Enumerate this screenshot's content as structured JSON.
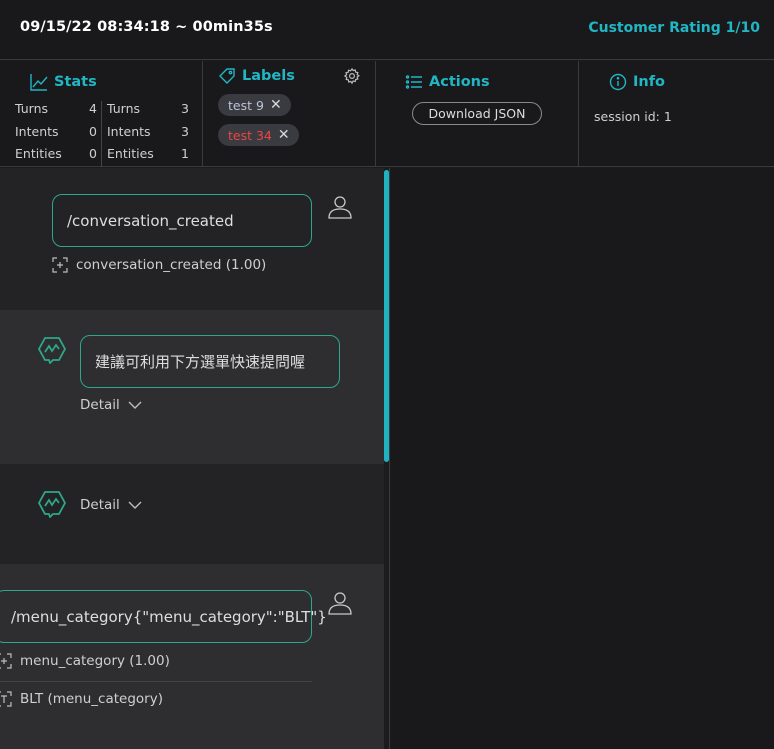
{
  "header": {
    "timestamp": "09/15/22 08:34:18 ~ 00min35s",
    "rating": "Customer Rating 1/10"
  },
  "stats": {
    "title": "Stats",
    "left": [
      {
        "label": "Turns",
        "value": "4"
      },
      {
        "label": "Intents",
        "value": "0"
      },
      {
        "label": "Entities",
        "value": "0"
      }
    ],
    "right": [
      {
        "label": "Turns",
        "value": "3"
      },
      {
        "label": "Intents",
        "value": "3"
      },
      {
        "label": "Entities",
        "value": "1"
      }
    ]
  },
  "labels": {
    "title": "Labels",
    "chips": [
      {
        "text": "test 9",
        "color": "#b9c4d8"
      },
      {
        "text": "test 34",
        "color": "#ee4444"
      }
    ],
    "remove_glyph": "✕"
  },
  "actions": {
    "title": "Actions",
    "download_label": "Download JSON"
  },
  "info": {
    "title": "Info",
    "session": "session id: 1"
  },
  "chat": {
    "messages": [
      {
        "role": "user",
        "text": "/conversation_created",
        "intent": "conversation_created (1.00)"
      },
      {
        "role": "bot",
        "text": "建議可利用下方選單快速提問喔",
        "detail_label": "Detail"
      },
      {
        "role": "bot",
        "detail_label": "Detail"
      },
      {
        "role": "user",
        "text": "/menu_category{\"menu_category\":\"BLT\"}",
        "intent": "menu_category (1.00)",
        "entity": "BLT (menu_category)"
      }
    ]
  },
  "colors": {
    "accent": "#20b6c4",
    "bubble_border": "#2ca88a",
    "chip_red": "#ee4444"
  }
}
